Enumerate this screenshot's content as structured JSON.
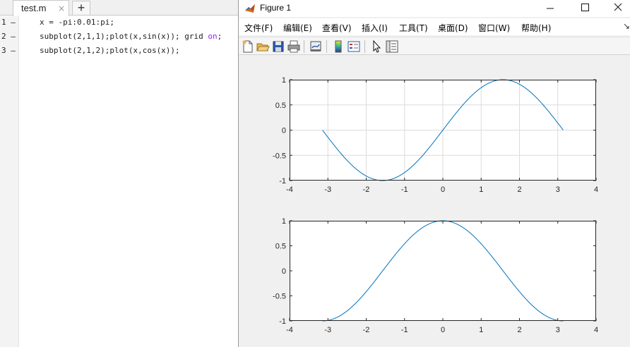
{
  "editor": {
    "tab_label": "test.m",
    "tab_close_glyph": "×",
    "new_tab_glyph": "+",
    "gutter": [
      {
        "num": "1",
        "mark": "–"
      },
      {
        "num": "2",
        "mark": "–"
      },
      {
        "num": "3",
        "mark": "–"
      }
    ],
    "lines": {
      "line1": "x = -pi:0.01:pi;",
      "line2_pre": "subplot(2,1,1);plot(x,sin(x)); grid ",
      "line2_kw": "on",
      "line2_post": ";",
      "line3": "subplot(2,1,2);plot(x,cos(x));"
    }
  },
  "figure": {
    "title": "Figure 1",
    "logo_icon": "matlab-logo-icon",
    "window_buttons": [
      "minimize-icon",
      "maximize-icon",
      "close-icon"
    ],
    "menu": [
      "文件(F)",
      "编辑(E)",
      "查看(V)",
      "插入(I)",
      "工具(T)",
      "桌面(D)",
      "窗口(W)",
      "帮助(H)"
    ],
    "menu_more_glyph": "↘",
    "toolbar_icons": [
      "new-figure-icon",
      "open-file-icon",
      "save-icon",
      "print-icon",
      "link-plot-icon",
      "colorbar-icon",
      "legend-icon",
      "pointer-icon",
      "property-inspector-icon"
    ],
    "plot_color": "#0072bd"
  },
  "chart_data": [
    {
      "type": "line",
      "function": "sin",
      "x_range": [
        -3.14,
        3.14
      ],
      "x_step": 0.01,
      "xlim": [
        -4,
        4
      ],
      "ylim": [
        -1,
        1
      ],
      "xticks": [
        "-4",
        "-3",
        "-2",
        "-1",
        "0",
        "1",
        "2",
        "3",
        "4"
      ],
      "yticks": [
        "1",
        "0.5",
        "0",
        "-0.5",
        "-1"
      ],
      "grid": true,
      "title": "",
      "xlabel": "",
      "ylabel": ""
    },
    {
      "type": "line",
      "function": "cos",
      "x_range": [
        -3.14,
        3.14
      ],
      "x_step": 0.01,
      "xlim": [
        -4,
        4
      ],
      "ylim": [
        -1,
        1
      ],
      "xticks": [
        "-4",
        "-3",
        "-2",
        "-1",
        "0",
        "1",
        "2",
        "3",
        "4"
      ],
      "yticks": [
        "1",
        "0.5",
        "0",
        "-0.5",
        "-1"
      ],
      "grid": false,
      "title": "",
      "xlabel": "",
      "ylabel": ""
    }
  ]
}
